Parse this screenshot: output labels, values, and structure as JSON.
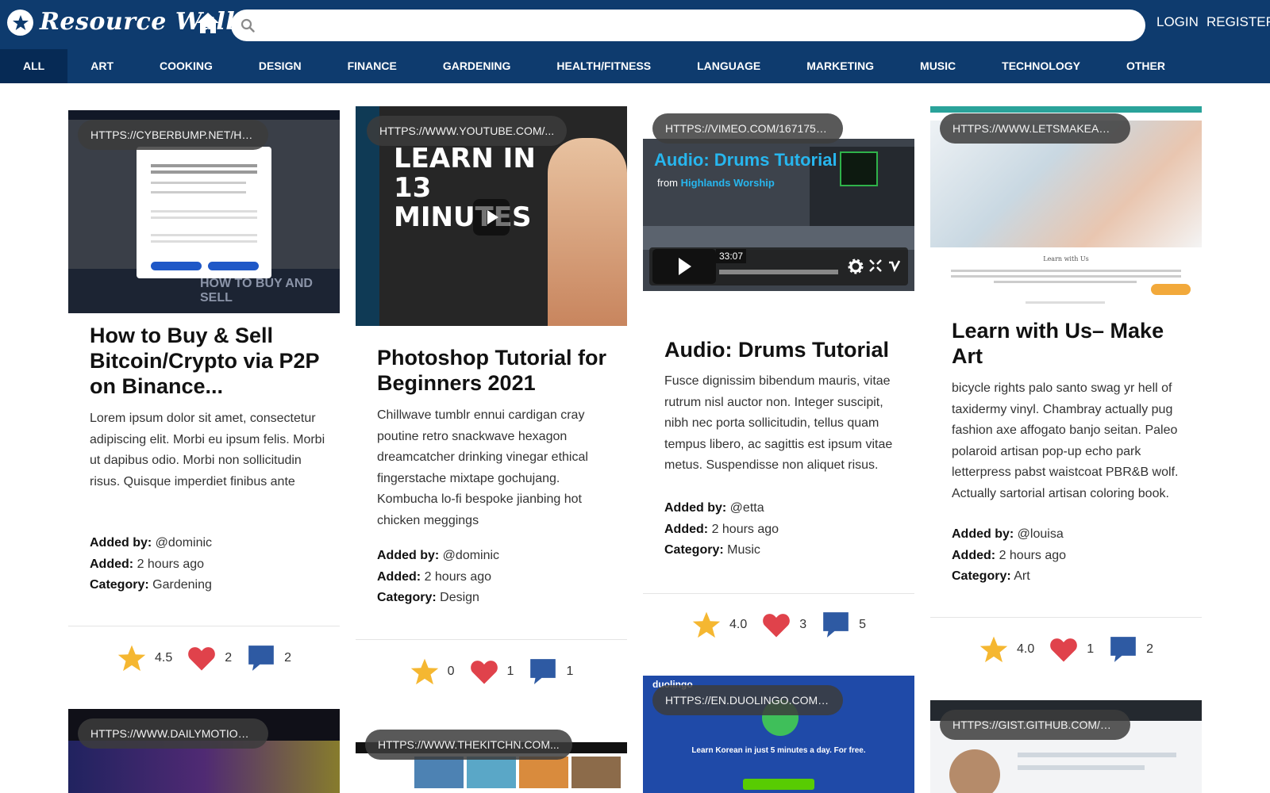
{
  "app": {
    "title": "Resource Wall",
    "search_placeholder": "",
    "login": "LOGIN",
    "register": "REGISTER"
  },
  "nav": [
    "ALL",
    "ART",
    "COOKING",
    "DESIGN",
    "FINANCE",
    "GARDENING",
    "HEALTH/FITNESS",
    "LANGUAGE",
    "MARKETING",
    "MUSIC",
    "TECHNOLOGY",
    "OTHER"
  ],
  "colors": {
    "header": "#0e3b6e",
    "nav_active": "#062a55",
    "star": "#f5b731",
    "heart": "#e0424b",
    "comment": "#2e5aa3"
  },
  "cards": [
    {
      "url": "HTTPS://CYBERBUMP.NET/HOW-...",
      "title": "How to Buy & Sell Bitcoin/Crypto via P2P on Binance...",
      "description": "Lorem ipsum dolor sit amet, consectetur adipiscing elit. Morbi eu ipsum felis. Morbi ut dapibus odio. Morbi non sollicitudin risus. Quisque imperdiet finibus ante",
      "added_by_label": "Added by:",
      "added_by": "@dominic",
      "added_label": "Added:",
      "added": "2 hours ago",
      "category_label": "Category:",
      "category": "Gardening",
      "rating": "4.5",
      "likes": "2",
      "comments": "2",
      "thumb_caption": "HOW TO BUY AND SELL"
    },
    {
      "url": "HTTPS://WWW.YOUTUBE.COM/...",
      "title": "Photoshop Tutorial for Beginners 2021",
      "description": "Chillwave tumblr ennui cardigan cray poutine retro snackwave hexagon dreamcatcher drinking vinegar ethical fingerstache mixtape gochujang. Kombucha lo-fi bespoke jianbing hot chicken meggings",
      "added_by_label": "Added by:",
      "added_by": "@dominic",
      "added_label": "Added:",
      "added": "2 hours ago",
      "category_label": "Category:",
      "category": "Design",
      "rating": "0",
      "likes": "1",
      "comments": "1",
      "thumb_caption": "LEARN IN 13 MINUTES"
    },
    {
      "url": "HTTPS://VIMEO.COM/167175768",
      "title": "Audio: Drums Tutorial",
      "description": "Fusce dignissim bibendum mauris, vitae rutrum nisl auctor non. Integer suscipit, nibh nec porta sollicitudin, tellus quam tempus libero, ac sagittis est ipsum vitae metus. Suspendisse non aliquet risus.",
      "added_by_label": "Added by:",
      "added_by": "@etta",
      "added_label": "Added:",
      "added": "2 hours ago",
      "category_label": "Category:",
      "category": "Music",
      "rating": "4.0",
      "likes": "3",
      "comments": "5",
      "thumb_caption": "Audio: Drums Tutorial",
      "thumb_from_prefix": "from",
      "thumb_from": "Highlands Worship",
      "thumb_time": "33:07"
    },
    {
      "url": "HTTPS://WWW.LETSMAKEART.C...",
      "title": "Learn with Us– Make Art",
      "description": "bicycle rights palo santo swag yr hell of taxidermy vinyl. Chambray actually pug fashion axe affogato banjo seitan. Paleo polaroid artisan pop-up echo park letterpress pabst waistcoat PBR&B wolf. Actually sartorial artisan coloring book.",
      "added_by_label": "Added by:",
      "added_by": "@louisa",
      "added_label": "Added:",
      "added": "2 hours ago",
      "category_label": "Category:",
      "category": "Art",
      "rating": "4.0",
      "likes": "1",
      "comments": "2",
      "thumb_caption": "Learn with Us"
    }
  ],
  "row2": [
    {
      "url": "HTTPS://WWW.DAILYMOTION.CO..."
    },
    {
      "url": "HTTPS://WWW.THEKITCHN.COM..."
    },
    {
      "url": "HTTPS://EN.DUOLINGO.COM/C...",
      "brand": "duolingo",
      "tagline": "Learn Korean in just 5 minutes a day. For free."
    },
    {
      "url": "HTTPS://GIST.GITHUB.COM/KVIR..."
    }
  ]
}
